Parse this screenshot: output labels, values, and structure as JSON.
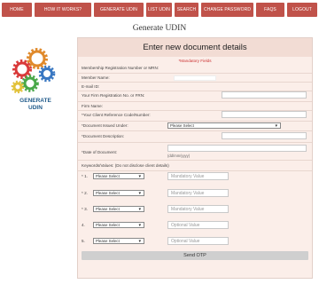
{
  "nav": [
    "HOME",
    "HOW IT WORKS?",
    "GENERATE UDIN",
    "LIST UDIN",
    "SEARCH",
    "CHANGE PASSWORD",
    "FAQS",
    "LOGOUT"
  ],
  "page_title": "Generate UDIN",
  "logo": {
    "line1": "GENERATE",
    "line2": "UDIN",
    "icon": "gears-icon"
  },
  "form": {
    "heading": "Enter new document details",
    "mandatory_note": "*Mandatory Fields",
    "labels": {
      "membership": "Membership Registration Number or MRN:",
      "member_name": "Member Name:",
      "email": "E-mail ID:",
      "firm_reg": "Your Firm Registration No. or FRN:",
      "firm_name": "Firm Name:",
      "client_ref": "*Your Client Reference Code/Number:",
      "doc_issued_under": "*Document Issued Under:",
      "doc_description": "*Document Description:",
      "doc_date": "*Date of Document:",
      "keywords": "Keywords/Values: (Do not disclose client details)"
    },
    "doc_issued_under_value": "Please Select",
    "date_hint": "(dd/mm/yyyy)",
    "keyword_rows": [
      {
        "num": "* 1.",
        "select": "Please Select",
        "placeholder": "Mandatory Value"
      },
      {
        "num": "* 2.",
        "select": "Please Select",
        "placeholder": "Mandatory Value"
      },
      {
        "num": "* 3.",
        "select": "Please Select",
        "placeholder": "Mandatory Value"
      },
      {
        "num": "4.",
        "select": "Please Select",
        "placeholder": "Optional Value"
      },
      {
        "num": "5.",
        "select": "Please Select",
        "placeholder": "Optional Value"
      }
    ],
    "send_otp": "Send OTP"
  },
  "colors": {
    "nav_bg": "#c0524a",
    "form_bg": "#fbeee9",
    "mandatory": "#cc3333",
    "logo_text": "#1f5a8a"
  }
}
